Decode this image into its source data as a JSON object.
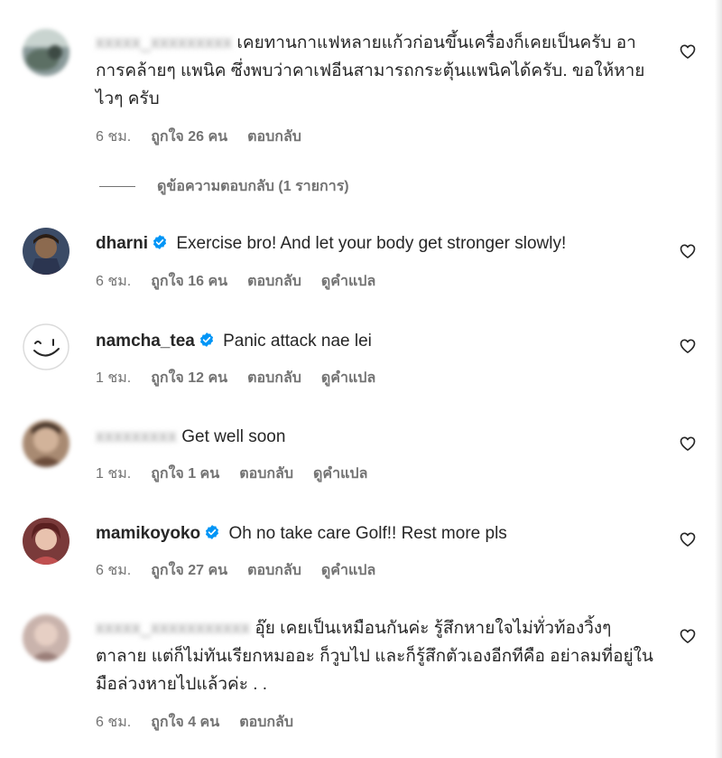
{
  "comments": [
    {
      "username": "",
      "blurred_username": "xxxxx_xxxxxxxxx",
      "text": "เคยทานกาแฟหลายแก้วก่อนขึ้นเครื่องก็เคยเป็นครับ อาการคล้ายๆ แพนิค ซึ่งพบว่าคาเฟอีนสามารถกระตุ้นแพนิคได้ครับ. ขอให้หายไวๆ ครับ",
      "time": "6 ชม.",
      "likes": "ถูกใจ 26 คน",
      "reply": "ตอบกลับ",
      "translate": ""
    },
    {
      "username": "dharni",
      "text": "Exercise bro! And let your body get stronger slowly!",
      "time": "6 ชม.",
      "likes": "ถูกใจ 16 คน",
      "reply": "ตอบกลับ",
      "translate": "ดูคำแปล"
    },
    {
      "username": "namcha_tea",
      "text": "Panic attack nae lei",
      "time": "1 ชม.",
      "likes": "ถูกใจ 12 คน",
      "reply": "ตอบกลับ",
      "translate": "ดูคำแปล"
    },
    {
      "username": "",
      "blurred_username": "xxxxxxxxx",
      "text": "Get well soon",
      "time": "1 ชม.",
      "likes": "ถูกใจ 1 คน",
      "reply": "ตอบกลับ",
      "translate": "ดูคำแปล"
    },
    {
      "username": "mamikoyoko",
      "text": "Oh no take care Golf!! Rest more pls",
      "time": "6 ชม.",
      "likes": "ถูกใจ 27 คน",
      "reply": "ตอบกลับ",
      "translate": "ดูคำแปล"
    },
    {
      "username": "",
      "blurred_username": "xxxxx_xxxxxxxxxxx",
      "text": "อุ๊ย เคยเป็นเหมือนกันค่ะ รู้สึกหายใจไม่ทั่วท้องวิ้งๆ ตาลาย แต่ก็ไม่ทันเรียกหมออะ ก็วูบไป และก็รู้สึกตัวเองอีกทีคือ อย่าลมที่อยู่ในมือล่วงหายไปแล้วค่ะ . .",
      "time": "6 ชม.",
      "likes": "ถูกใจ 4 คน",
      "reply": "ตอบกลับ",
      "translate": ""
    }
  ],
  "view_replies": "ดูข้อความตอบกลับ (1 รายการ)",
  "colors": {
    "text": "#262626",
    "secondary": "#737373",
    "verified": "#0095f6"
  },
  "icons": {
    "like": "heart-outline-icon",
    "verified": "verified-badge-icon"
  }
}
